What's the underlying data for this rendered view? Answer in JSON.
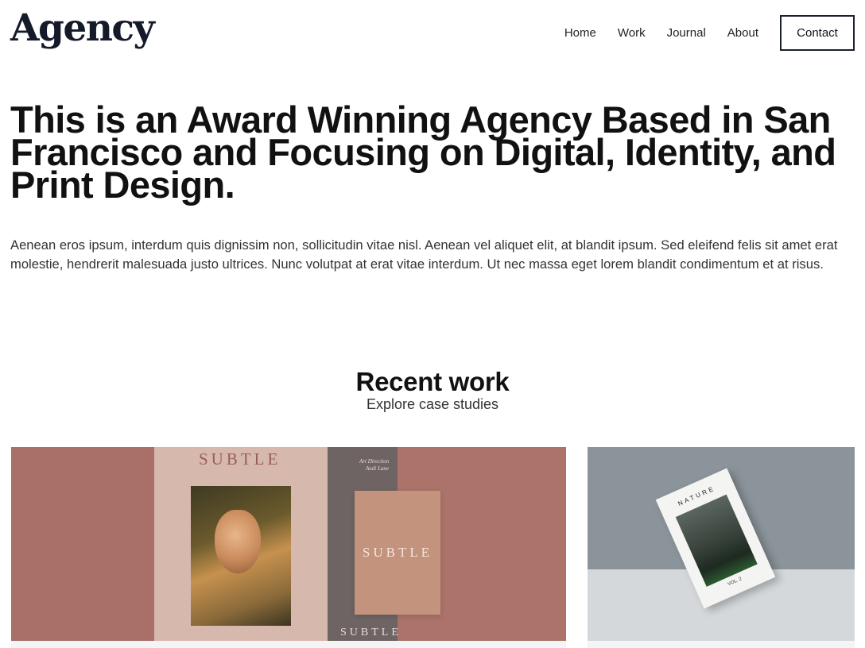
{
  "header": {
    "logo": "Agency",
    "nav": [
      {
        "label": "Home"
      },
      {
        "label": "Work"
      },
      {
        "label": "Journal"
      },
      {
        "label": "About"
      }
    ],
    "contact_label": "Contact"
  },
  "hero": {
    "title": "This is an Award Winning Agency Based in San Francisco and Focusing on Digital, Identity, and Print Design.",
    "text": "Aenean eros ipsum, interdum quis dignissim non, sollicitudin vitae nisl. Aenean vel aliquet elit, at blandit ipsum. Sed eleifend felis sit amet erat molestie, hendrerit malesuada justo ultrices. Nunc volutpat at erat vitae interdum. Ut nec massa eget lorem blandit condimentum et at risus."
  },
  "recent_work": {
    "title": "Recent work",
    "subtitle": "Explore case studies"
  },
  "cards": [
    {
      "art_word_top": "SUBTLE",
      "art_word_card": "SUBTLE",
      "art_word_bottom": "SUBTLE",
      "art_small_1": "Art Direction",
      "art_small_2": "Andi Lane",
      "colors": {
        "background": "#a66f66",
        "panel": "#d7b8ad"
      }
    },
    {
      "book_title": "NATURE",
      "book_vol": "VOL. 2",
      "colors": {
        "wall": "#8b949b",
        "floor": "#d4d8db"
      }
    }
  ]
}
